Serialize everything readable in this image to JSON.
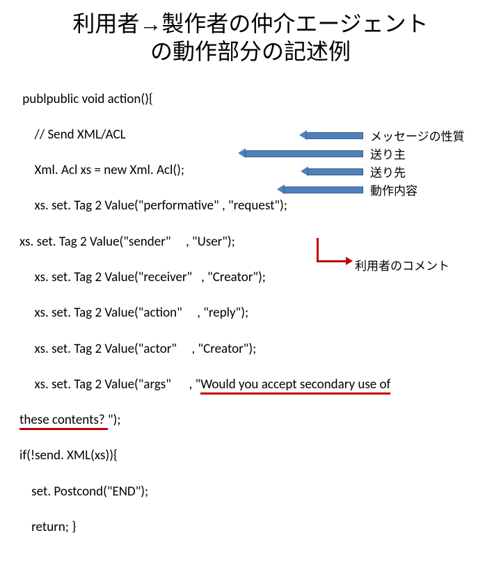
{
  "title_line1": "利用者→製作者の仲介エージェント",
  "title_line2": "の動作部分の記述例",
  "code": {
    "l1": " publpublic void action(){",
    "l2": "     // Send XML/ACL",
    "l3": "     Xml. Acl xs = new Xml. Acl();",
    "l4a": "     xs. set. Tag 2 Value(\"performative\" , \"request\");",
    "l5": "xs. set. Tag 2 Value(\"sender\"     , \"User\");",
    "l6": "     xs. set. Tag 2 Value(\"receiver\"   , \"Creator\");",
    "l7": "     xs. set. Tag 2 Value(\"action\"     , \"reply\");",
    "l8": "     xs. set. Tag 2 Value(\"actor\"     , \"Creator\");",
    "l9a": "     xs. set. Tag 2 Value(\"args\"      , \"",
    "l9b": "Would you accept secondary use of",
    "l10a": "these contents? ",
    "l10b": "\");",
    "l11": "if(!send. XML(xs)){",
    "l12": "    set. Postcond(\"END\");",
    "l13": "    return; }"
  },
  "annot": {
    "a1": "メッセージの性質",
    "a2": "送り主",
    "a3": "送り先",
    "a4": "動作内容",
    "a5": "利用者のコメント"
  }
}
